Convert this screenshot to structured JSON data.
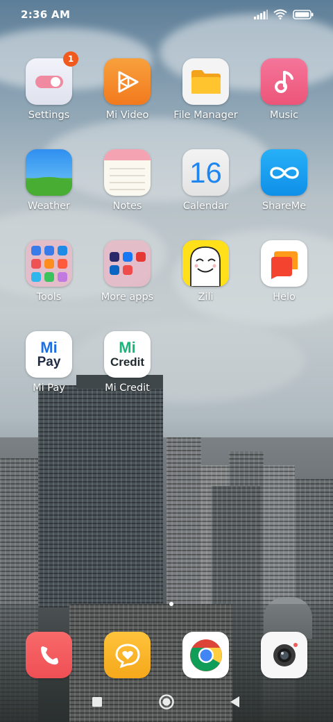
{
  "status_bar": {
    "time": "2:36 AM",
    "icons": [
      "signal-icon",
      "wifi-icon",
      "battery-icon"
    ]
  },
  "apps": [
    {
      "label": "Settings",
      "icon": "settings-toggle-icon",
      "badge": "1"
    },
    {
      "label": "Mi Video",
      "icon": "play-icon"
    },
    {
      "label": "File Manager",
      "icon": "folder-icon"
    },
    {
      "label": "Music",
      "icon": "music-note-icon"
    },
    {
      "label": "Weather",
      "icon": "weather-icon"
    },
    {
      "label": "Notes",
      "icon": "notes-icon"
    },
    {
      "label": "Calendar",
      "icon": "calendar-icon",
      "date_number": "16"
    },
    {
      "label": "ShareMe",
      "icon": "infinity-icon"
    },
    {
      "label": "Tools",
      "icon": "folder-tools-icon"
    },
    {
      "label": "More apps",
      "icon": "folder-more-apps-icon"
    },
    {
      "label": "Zili",
      "icon": "zili-face-icon"
    },
    {
      "label": "Helo",
      "icon": "chat-bubbles-icon"
    },
    {
      "label": "Mi Pay",
      "icon": "mi-pay-icon",
      "logo_line1": "Mi",
      "logo_line2": "Pay"
    },
    {
      "label": "Mi Credit",
      "icon": "mi-credit-icon",
      "logo_line1": "Mi",
      "logo_line2": "Credit"
    }
  ],
  "dock": [
    {
      "name": "phone",
      "icon": "phone-icon"
    },
    {
      "name": "messaging",
      "icon": "message-heart-icon"
    },
    {
      "name": "chrome",
      "icon": "chrome-icon"
    },
    {
      "name": "camera",
      "icon": "camera-icon"
    }
  ],
  "page_indicator": {
    "pages": 1,
    "current": 1
  },
  "nav_bar": [
    "recents-button",
    "home-button",
    "back-button"
  ],
  "colors": {
    "badge": "#f05a1e",
    "mi_video": "#f48a2a",
    "file_manager": "#ffb423",
    "music": "#f0607e",
    "shareme": "#1aa0f0",
    "mi_green": "#19b67a",
    "mi_blue": "#1f6fe0"
  }
}
